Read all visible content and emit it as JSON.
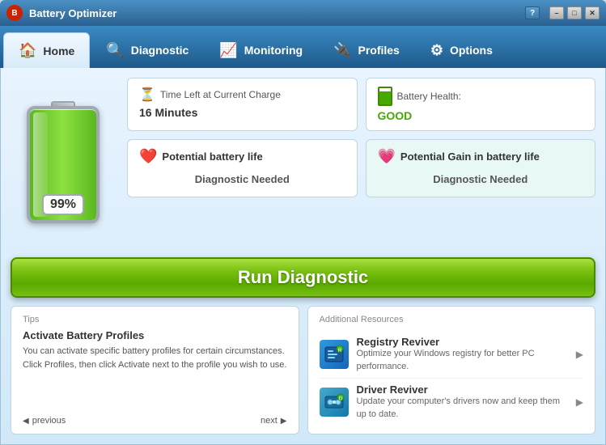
{
  "titleBar": {
    "logo": "B",
    "title": "Battery Optimizer",
    "helpLabel": "?",
    "minimizeLabel": "–",
    "maximizeLabel": "□",
    "closeLabel": "✕"
  },
  "nav": {
    "tabs": [
      {
        "id": "home",
        "label": "Home",
        "icon": "🏠",
        "active": true
      },
      {
        "id": "diagnostic",
        "label": "Diagnostic",
        "icon": "🔍",
        "active": false
      },
      {
        "id": "monitoring",
        "label": "Monitoring",
        "icon": "📈",
        "active": false
      },
      {
        "id": "profiles",
        "label": "Profiles",
        "icon": "🔌",
        "active": false
      },
      {
        "id": "options",
        "label": "Options",
        "icon": "⚙",
        "active": false
      }
    ]
  },
  "battery": {
    "percent": "99%",
    "percentNum": 99
  },
  "timeLeft": {
    "label": "Time Left at Current Charge",
    "value": "16 Minutes"
  },
  "batteryHealth": {
    "label": "Battery Health:",
    "value": "GOOD"
  },
  "potentialLife": {
    "title": "Potential battery life",
    "value": "Diagnostic Needed"
  },
  "potentialGain": {
    "title": "Potential Gain in battery life",
    "value": "Diagnostic Needed"
  },
  "runDiagnostic": {
    "label": "Run Diagnostic"
  },
  "tips": {
    "sectionLabel": "Tips",
    "title": "Activate Battery Profiles",
    "text": "You can activate specific battery profiles for certain circumstances. Click Profiles, then click Activate next to the profile you wish to use.",
    "prevLabel": "previous",
    "nextLabel": "next"
  },
  "resources": {
    "sectionLabel": "Additional Resources",
    "items": [
      {
        "id": "registry-reviver",
        "title": "Registry Reviver",
        "desc": "Optimize your Windows registry for better PC performance."
      },
      {
        "id": "driver-reviver",
        "title": "Driver Reviver",
        "desc": "Update your computer's drivers now and keep them up to date."
      }
    ]
  }
}
